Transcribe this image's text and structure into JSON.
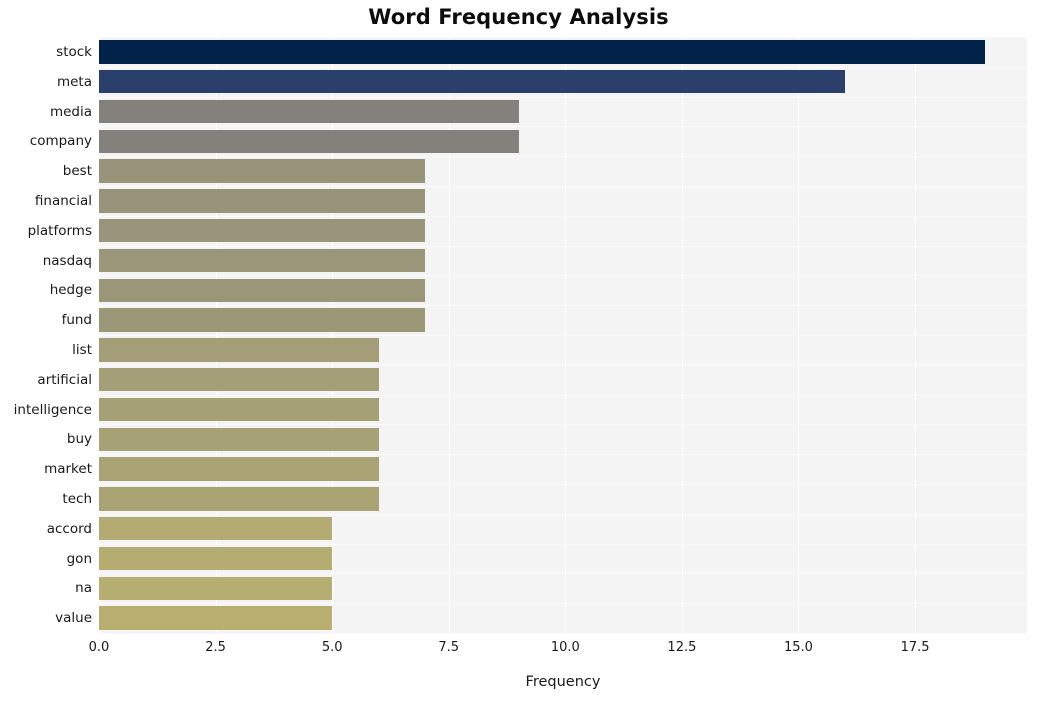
{
  "chart_data": {
    "type": "bar",
    "orientation": "horizontal",
    "title": "Word Frequency Analysis",
    "xlabel": "Frequency",
    "ylabel": "",
    "categories": [
      "stock",
      "meta",
      "media",
      "company",
      "best",
      "financial",
      "platforms",
      "nasdaq",
      "hedge",
      "fund",
      "list",
      "artificial",
      "intelligence",
      "buy",
      "market",
      "tech",
      "accord",
      "gon",
      "na",
      "value"
    ],
    "values": [
      19,
      16,
      9,
      9,
      7,
      7,
      7,
      7,
      7,
      7,
      6,
      6,
      6,
      6,
      6,
      6,
      5,
      5,
      5,
      5
    ],
    "bar_colors": [
      "#022349",
      "#2b3f6c",
      "#84817c",
      "#84817c",
      "#98947a",
      "#98947a",
      "#99957a",
      "#9a9679",
      "#9a9778",
      "#9b9877",
      "#a49e78",
      "#a59f78",
      "#a6a077",
      "#a7a176",
      "#a8a275",
      "#a9a374",
      "#b4ab73",
      "#b5ac72",
      "#b6ad71",
      "#b7ae70"
    ],
    "xlim": [
      0,
      19.9
    ],
    "xticks": [
      0.0,
      2.5,
      5.0,
      7.5,
      10.0,
      12.5,
      15.0,
      17.5
    ],
    "xtick_labels": [
      "0.0",
      "2.5",
      "5.0",
      "7.5",
      "10.0",
      "12.5",
      "15.0",
      "17.5"
    ],
    "grid": true,
    "grid_color": "#ffffff",
    "plot_background": "#f4f4f5",
    "figure_background": "#ffffff",
    "legend": null
  }
}
